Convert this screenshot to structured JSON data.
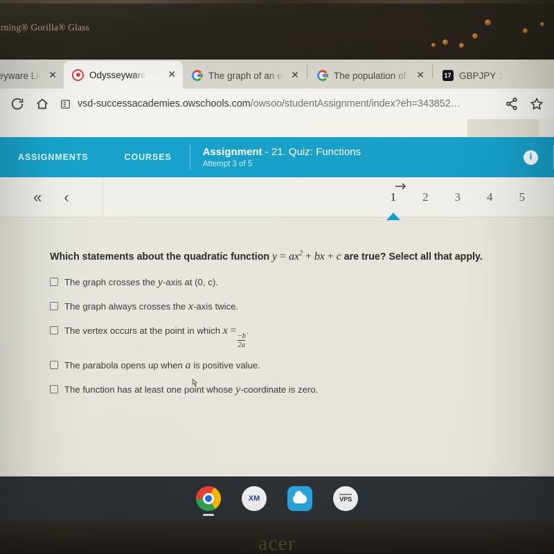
{
  "device": {
    "bezel_brand_text": "orning® Gorilla® Glass",
    "bottom_brand": "acer"
  },
  "browser": {
    "tabs": [
      {
        "title": "sseyware Link",
        "favicon": "none-icon",
        "active": false,
        "close_label": "✕"
      },
      {
        "title": "Odysseyware",
        "favicon": "odysseyware-icon",
        "active": true,
        "close_label": "✕"
      },
      {
        "title": "The graph of an exp",
        "favicon": "google-icon",
        "active": false,
        "close_label": "✕"
      },
      {
        "title": "The population of a",
        "favicon": "google-icon",
        "active": false,
        "close_label": "✕"
      },
      {
        "title": "GBPJPY 1",
        "favicon": "tradingview-icon",
        "active": false,
        "close_label": ""
      }
    ],
    "toolbar": {
      "reload_icon": "reload-icon",
      "home_icon": "home-icon",
      "site_info_icon": "page-info-icon",
      "url_main": "vsd-successacademies.owschools.com",
      "url_path": "/owsoo/studentAssignment/index?eh=343852…",
      "share_icon": "share-icon",
      "bookmark_icon": "star-icon"
    }
  },
  "app_header": {
    "nav": [
      {
        "label": "ASSIGNMENTS"
      },
      {
        "label": "COURSES"
      }
    ],
    "assignment_label": "Assignment",
    "assignment_title": "- 21. Quiz: Functions",
    "attempt_text": "Attempt 3 of 5",
    "info_icon": "info-icon",
    "accent_color": "#17a0c9"
  },
  "pager": {
    "first_label": "«",
    "prev_label": "‹",
    "arrow_icon": "arrow-right-icon",
    "pages": [
      {
        "label": "1",
        "active": true
      },
      {
        "label": "2",
        "active": false
      },
      {
        "label": "3",
        "active": false
      },
      {
        "label": "4",
        "active": false
      },
      {
        "label": "5",
        "active": false
      }
    ]
  },
  "question": {
    "prefix": "Which statements about the quadratic function",
    "math_y": "y",
    "math_eq": "=",
    "math_a": "a",
    "math_x": "x",
    "math_exp": "2",
    "math_plus1": "+",
    "math_b": "b",
    "math_x2": "x",
    "math_plus2": "+",
    "math_c": "c",
    "suffix": "are true? Select all that apply.",
    "options": [
      {
        "id": "opt-1",
        "text_before": "The graph crosses the",
        "math_var": "y",
        "text_after": "-axis at (0, c).",
        "checked": false
      },
      {
        "id": "opt-2",
        "text_before": "The graph always crosses the",
        "math_var": "x",
        "text_after": "-axis twice.",
        "checked": false
      },
      {
        "id": "opt-3",
        "text_before": "The vertex occurs at the point in which",
        "math_var": "x",
        "text_after": "=",
        "fraction_num": "−b",
        "fraction_den": "2a",
        "text_end": ".",
        "checked": false
      },
      {
        "id": "opt-4",
        "text_before": "The parabola opens up when",
        "math_var": "a",
        "text_after": "is positive value.",
        "checked": false
      },
      {
        "id": "opt-5",
        "text_before": "The function has at least one point whose",
        "math_var": "y",
        "text_after": "-coordinate is zero.",
        "checked": false
      }
    ]
  },
  "shelf": {
    "items": [
      {
        "name": "chrome",
        "label": "",
        "icon": "chrome-icon",
        "active": true
      },
      {
        "name": "xm",
        "label": "XM",
        "icon": "xm-icon",
        "active": false
      },
      {
        "name": "cloud",
        "label": "",
        "icon": "cloud-icon",
        "active": false
      },
      {
        "name": "vps",
        "label": "VPS",
        "icon": "vps-icon",
        "active": false
      }
    ]
  }
}
